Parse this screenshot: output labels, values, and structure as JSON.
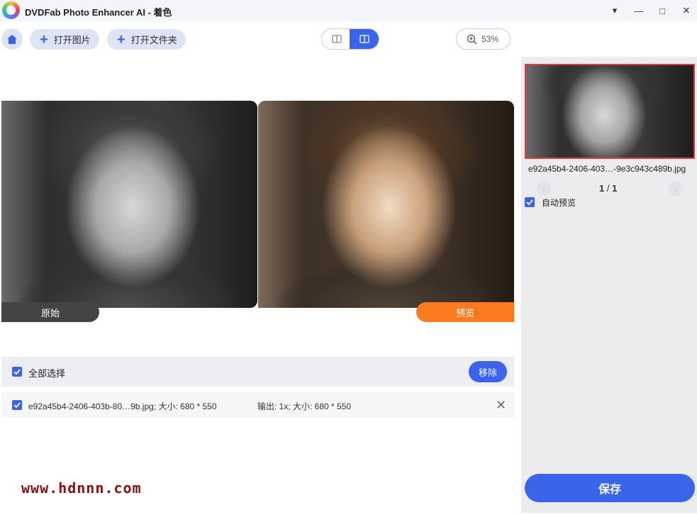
{
  "window": {
    "title": "DVDFab Photo Enhancer AI - 着色",
    "controls": [
      "▾",
      "—",
      "□",
      "✕"
    ]
  },
  "toolbar": {
    "open_image": "打开图片",
    "open_folder": "打开文件夹",
    "zoom": "53%",
    "view_mode": "split"
  },
  "compare": {
    "original_label": "原始",
    "preview_label": "预览"
  },
  "list": {
    "select_all": "全部选择",
    "remove": "移除",
    "rows": [
      {
        "name": "e92a45b4-2406-403b-80…9b.jpg; 大小: 680 * 550",
        "output": "输出: 1x; 大小: 680 * 550",
        "checked": true
      }
    ]
  },
  "sidebar": {
    "thumb_name": "e92a45b4-2406-403…-9e3c943c489b.jpg",
    "pager_current": "1",
    "pager_sep": " / ",
    "pager_total": "1",
    "auto_preview": "自动预览",
    "save": "保存"
  },
  "watermark": "www.hdnnn.com",
  "colors": {
    "accent": "#3b64ed",
    "preview_tag": "#fb7a1e",
    "original_tag": "#444444"
  }
}
